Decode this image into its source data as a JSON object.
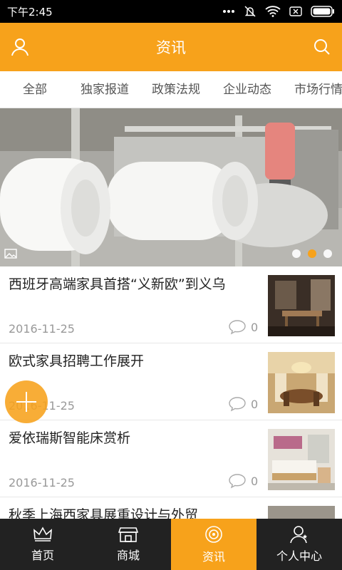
{
  "status_bar": {
    "time": "下午2:45"
  },
  "header": {
    "title": "资讯",
    "left_icon": "user-icon",
    "right_icon": "search-icon"
  },
  "tabs": [
    {
      "label": "全部"
    },
    {
      "label": "独家报道"
    },
    {
      "label": "政策法规"
    },
    {
      "label": "企业动态"
    },
    {
      "label": "市场行情"
    }
  ],
  "banner": {
    "slide_count": 3,
    "active_slide": 2
  },
  "news": [
    {
      "title": "西班牙高端家具首搭“义新欧”到义乌",
      "date": "2016-11-25",
      "comments": "0"
    },
    {
      "title": "欧式家具招聘工作展开",
      "date": "2016-11-25",
      "comments": "0"
    },
    {
      "title": "爱依瑞斯智能床赏析",
      "date": "2016-11-25",
      "comments": "0"
    },
    {
      "title": "秋季上海西家具展重设计与外贸",
      "date": "",
      "comments": ""
    }
  ],
  "bottom_nav": [
    {
      "label": "首页",
      "icon": "crown-icon"
    },
    {
      "label": "商城",
      "icon": "store-icon"
    },
    {
      "label": "资讯",
      "icon": "news-icon",
      "active": true
    },
    {
      "label": "个人中心",
      "icon": "person-icon"
    }
  ],
  "colors": {
    "accent": "#f7a21b",
    "nav_bg": "#222222"
  }
}
